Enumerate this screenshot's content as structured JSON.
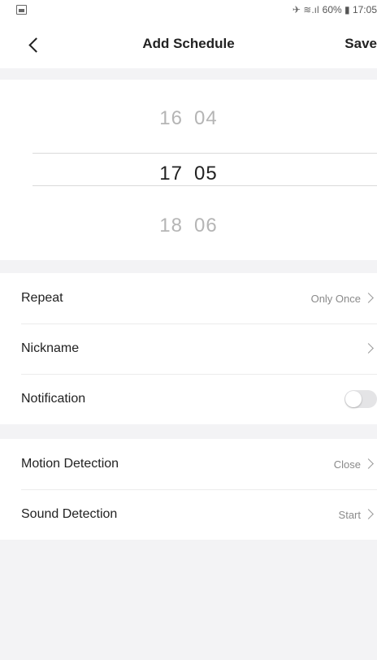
{
  "status_bar": {
    "left_icon": "image-icon",
    "right_text": "60% ▮ 17:05",
    "right_icons": "✈ ≋.ıl"
  },
  "header": {
    "back_icon": "chevron-left-icon",
    "title": "Add Schedule",
    "save_label": "Save"
  },
  "picker": {
    "prev": {
      "hour": "16",
      "minute": "04"
    },
    "current": {
      "hour": "17",
      "minute": "05"
    },
    "next": {
      "hour": "18",
      "minute": "06"
    }
  },
  "settings": {
    "repeat": {
      "label": "Repeat",
      "value": "Only Once"
    },
    "nickname": {
      "label": "Nickname",
      "value": ""
    },
    "notification": {
      "label": "Notification",
      "enabled": false
    },
    "motion": {
      "label": "Motion Detection",
      "value": "Close"
    },
    "sound": {
      "label": "Sound Detection",
      "value": "Start"
    }
  },
  "colors": {
    "background": "#f3f3f5",
    "surface": "#ffffff",
    "text": "#222222",
    "muted": "#8a8a8a",
    "toggle_off": "#e4e4e6"
  }
}
